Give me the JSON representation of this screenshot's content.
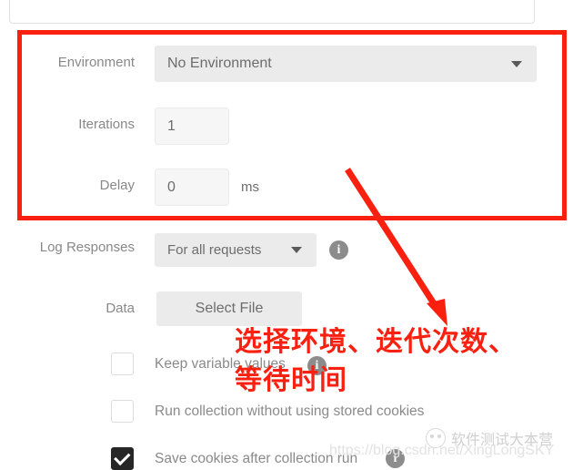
{
  "app": {
    "name": "postman-collection-runner-settings"
  },
  "form": {
    "environment": {
      "label": "Environment",
      "value": "No Environment",
      "caret_icon": "chevron-down-icon"
    },
    "iterations": {
      "label": "Iterations",
      "value": "1"
    },
    "delay": {
      "label": "Delay",
      "value": "0",
      "unit": "ms"
    },
    "log_responses": {
      "label": "Log Responses",
      "value": "For all requests",
      "caret_icon": "chevron-down-icon",
      "info_icon": "info-icon"
    },
    "data": {
      "label": "Data",
      "button_label": "Select File"
    }
  },
  "options": [
    {
      "label": "Keep variable values",
      "checked": false,
      "has_info": true
    },
    {
      "label": "Run collection without using stored cookies",
      "checked": false,
      "has_info": false
    },
    {
      "label": "Save cookies after collection run",
      "checked": true,
      "has_info": true
    }
  ],
  "annotation": {
    "color": "#fa2010",
    "line1": "选择环境、迭代次数、",
    "line2": "等待时间",
    "arrow_icon": "arrow-down-right-icon",
    "highlight_icon": "red-rectangle-highlight"
  },
  "watermark": {
    "url": "https://blog.csdn.net/XingLongSKY",
    "brand": "软件测试大本营",
    "badge_icon": "panda-avatar-icon"
  }
}
